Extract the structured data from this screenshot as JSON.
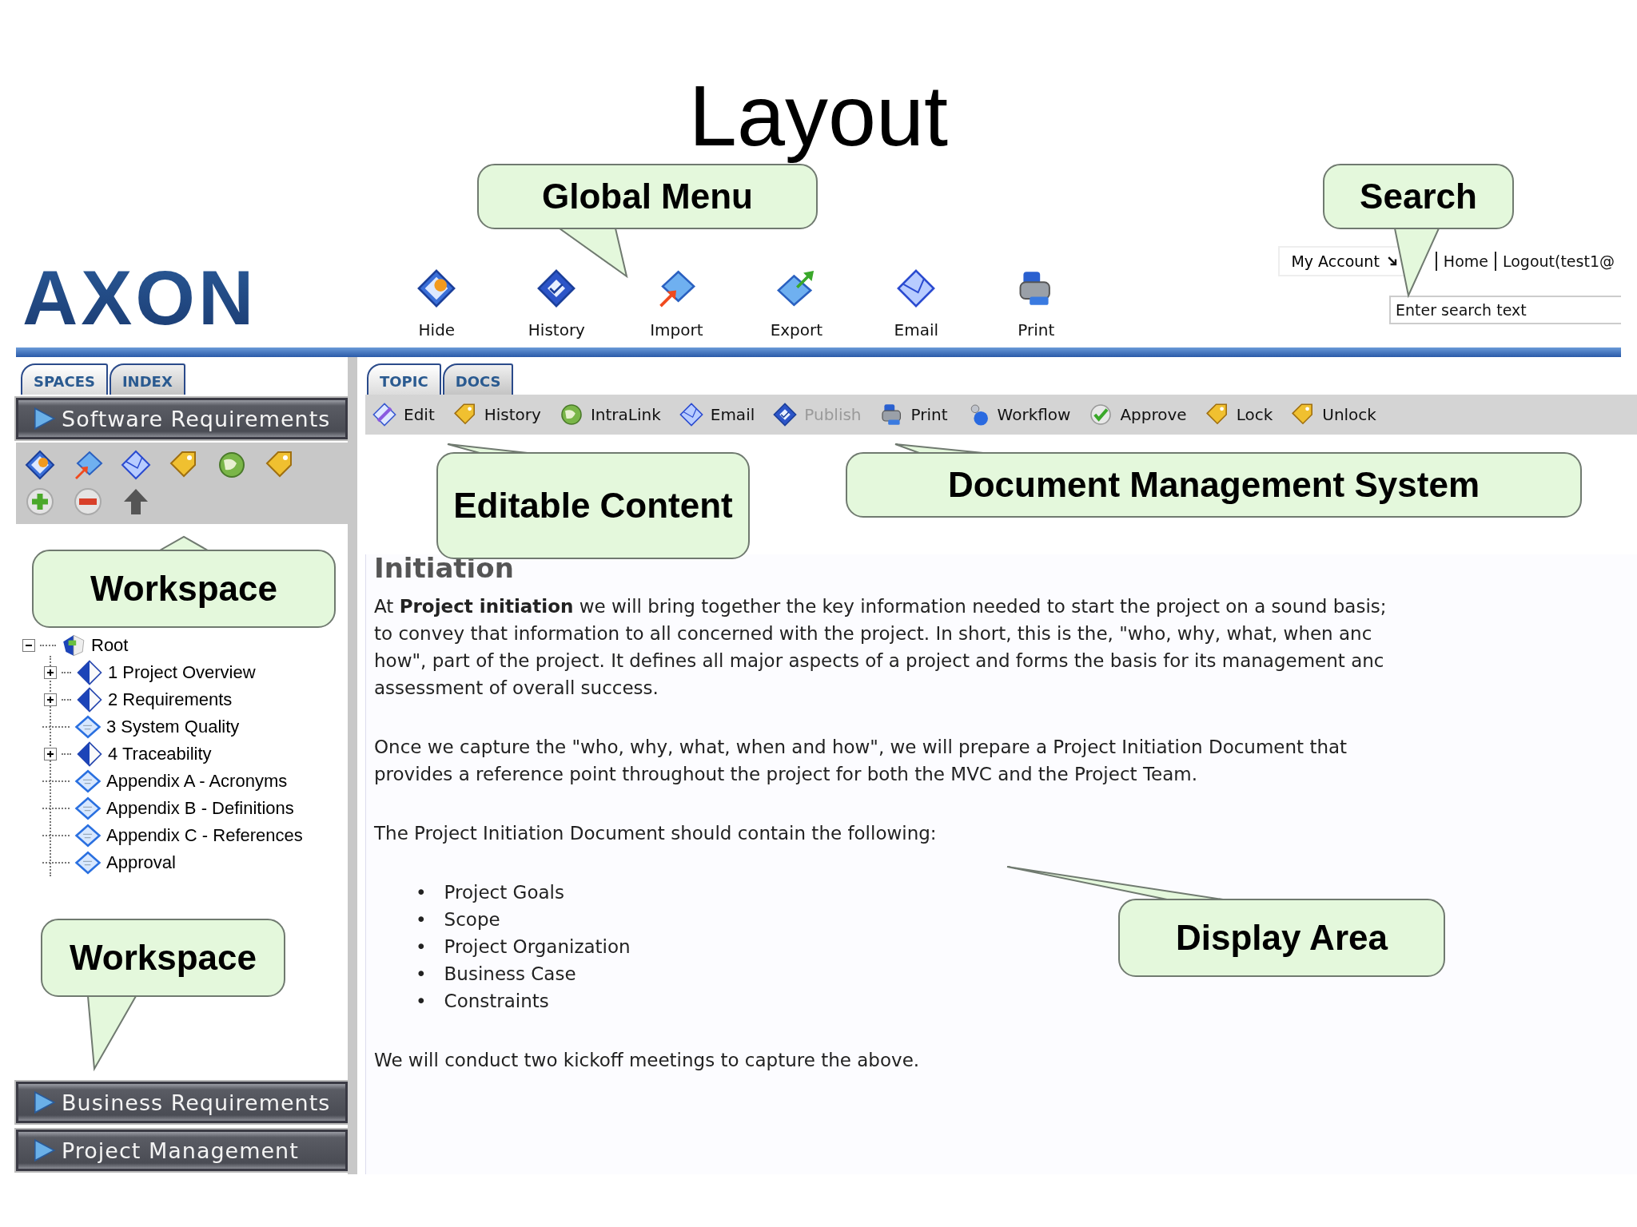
{
  "slide_title": "Layout",
  "header": {
    "logo": "AXON",
    "global_menu": [
      {
        "label": "Hide"
      },
      {
        "label": "History"
      },
      {
        "label": "Import"
      },
      {
        "label": "Export"
      },
      {
        "label": "Email"
      },
      {
        "label": "Print"
      }
    ],
    "account_links": [
      {
        "label": "My Account",
        "kind": "menu"
      },
      {
        "label": "Home",
        "kind": "link"
      },
      {
        "label": "Logout(test1@",
        "kind": "link"
      }
    ],
    "search": {
      "placeholder": "Enter search text"
    }
  },
  "sidebar": {
    "tabs": [
      {
        "label": "SPACES",
        "selected": true
      },
      {
        "label": "INDEX",
        "selected": false
      }
    ],
    "open_space": {
      "label": "Software Requirements"
    },
    "spaces": [
      {
        "label": "Business Requirements"
      },
      {
        "label": "Project Management"
      }
    ],
    "tree": {
      "label": "Root",
      "expanded": true,
      "children": [
        {
          "label": "1 Project Overview",
          "kind": "folder",
          "expanded": false
        },
        {
          "label": "2 Requirements",
          "kind": "folder",
          "expanded": false
        },
        {
          "label": "3 System Quality",
          "kind": "page"
        },
        {
          "label": "4 Traceability",
          "kind": "folder",
          "expanded": false
        },
        {
          "label": "Appendix A - Acronyms",
          "kind": "page"
        },
        {
          "label": "Appendix B - Definitions",
          "kind": "page"
        },
        {
          "label": "Appendix C - References",
          "kind": "page"
        },
        {
          "label": "Approval",
          "kind": "page"
        }
      ]
    }
  },
  "content": {
    "tabs": [
      {
        "label": "TOPIC",
        "selected": true
      },
      {
        "label": "DOCS",
        "selected": false
      }
    ],
    "toolbar": [
      {
        "label": "Edit",
        "disabled": false
      },
      {
        "label": "History",
        "disabled": false
      },
      {
        "label": "IntraLink",
        "disabled": false
      },
      {
        "label": "Email",
        "disabled": false
      },
      {
        "label": "Publish",
        "disabled": true
      },
      {
        "label": "Print",
        "disabled": false
      },
      {
        "label": "Workflow",
        "disabled": false
      },
      {
        "label": "Approve",
        "disabled": false
      },
      {
        "label": "Lock",
        "disabled": false
      },
      {
        "label": "Unlock",
        "disabled": false
      }
    ],
    "heading": "Initiation",
    "blocks": [
      {
        "kind": "paragraph",
        "text": "At **Project initiation** we will bring together the key information needed to start the project on a sound basis;\nto convey that information to all concerned with the project. In short, this is the, \"who, why, what, when anc\nhow\", part of the project. It defines all major aspects of a project and forms the basis for its management anc\nassessment of overall success."
      },
      {
        "kind": "paragraph",
        "text": "Once we capture the \"who, why, what, when and how\", we will prepare a Project Initiation Document that\nprovides a reference point throughout the project for both the MVC and the Project Team."
      },
      {
        "kind": "paragraph",
        "text": "The Project Initiation Document should contain the following:"
      },
      {
        "kind": "list",
        "items": [
          {
            "bullet": "•",
            "text": "Project Goals"
          },
          {
            "bullet": "•",
            "text": "Scope"
          },
          {
            "bullet": "•",
            "text": "Project Organization"
          },
          {
            "bullet": "•",
            "text": "Business Case"
          },
          {
            "bullet": "•",
            "text": "Constraints"
          }
        ]
      },
      {
        "kind": "paragraph",
        "text": "We will conduct two kickoff meetings to capture the above."
      }
    ]
  },
  "callouts": [
    {
      "text": "Global Menu"
    },
    {
      "text": "Search"
    },
    {
      "text": "Workspace"
    },
    {
      "text": "Editable Content"
    },
    {
      "text": "Document Management System"
    },
    {
      "text": "Display Area"
    },
    {
      "text": "Workspace"
    }
  ]
}
